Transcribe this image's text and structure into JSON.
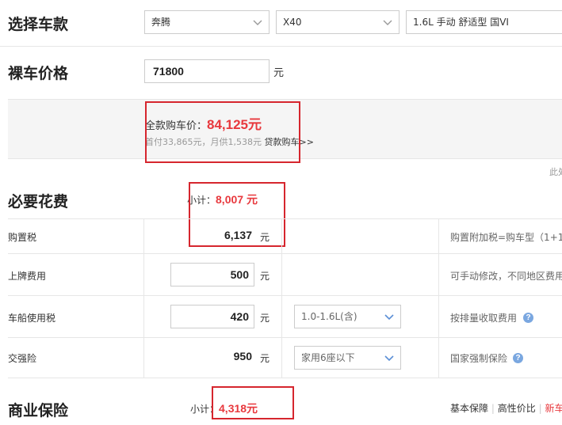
{
  "select_car": {
    "title": "选择车款",
    "brand": "奔腾",
    "model": "X40",
    "trim": "1.6L 手动 舒适型 国VI"
  },
  "bare_price": {
    "title": "裸车价格",
    "value": "71800",
    "unit": "元"
  },
  "full_price": {
    "label": "全款购车价：",
    "value": "84,125元",
    "detail": "首付33,865元，月供1,538元",
    "loan_link": "贷款购车>>",
    "side_text": "此处"
  },
  "required_fees": {
    "title": "必要花费",
    "subtotal_label": "小计：",
    "subtotal_value": "8,007 元",
    "rows": [
      {
        "name": "购置税",
        "value": "6,137",
        "unit": "元",
        "option": "",
        "note": "购置附加税=购车型（1+1"
      },
      {
        "name": "上牌费用",
        "value": "500",
        "unit": "元",
        "option": "",
        "note": "可手动修改，不同地区费用"
      },
      {
        "name": "车船使用税",
        "value": "420",
        "unit": "元",
        "option": "1.0-1.6L(含)",
        "note": "按排量收取费用"
      },
      {
        "name": "交强险",
        "value": "950",
        "unit": "元",
        "option": "家用6座以下",
        "note": "国家强制保险"
      }
    ]
  },
  "commercial_insurance": {
    "title": "商业保险",
    "subtotal_label": "小计：",
    "subtotal_value": "4,318元",
    "tabs": [
      "基本保障",
      "高性价比",
      "新车"
    ],
    "separator": "|"
  },
  "colors": {
    "accent_red": "#e8383d",
    "highlight_box": "#d6262e",
    "help_icon": "#7aa7e0"
  }
}
